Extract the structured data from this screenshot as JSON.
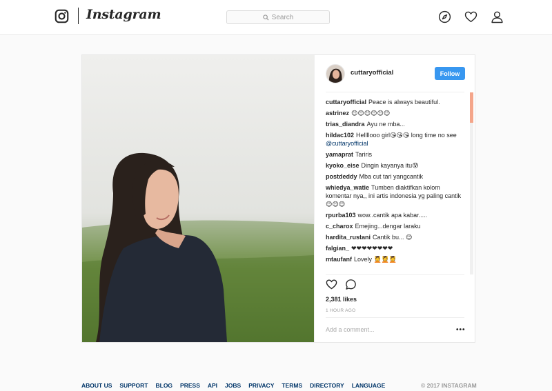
{
  "app": {
    "name": "Instagram"
  },
  "search": {
    "placeholder": "Search"
  },
  "post": {
    "username": "cuttaryofficial",
    "follow_label": "Follow",
    "likes": "2,381 likes",
    "time": "1 HOUR AGO",
    "add_comment_placeholder": "Add a comment...",
    "more_label": "•••",
    "comments": [
      {
        "user": "cuttaryofficial",
        "text": "Peace is always beautiful."
      },
      {
        "user": "astrinez",
        "text": "😊😊😊😊😊😊"
      },
      {
        "user": "trias_diandra",
        "text": "Ayu ne mba..."
      },
      {
        "user": "hildac102",
        "text": "Hellllooo girl😘😘😘 long time no see",
        "mention": "@cuttaryofficial"
      },
      {
        "user": "yamaprat",
        "text": "Tariris"
      },
      {
        "user": "kyoko_eise",
        "text": "Dingin kayanya itu😰"
      },
      {
        "user": "postdeddy",
        "text": "Mba cut tari yangcantik"
      },
      {
        "user": "whiedya_watie",
        "text": "Tumben diaktifkan kolom komentar nya,, ini artis indonesia yg paling cantik 😊😊😊"
      },
      {
        "user": "rpurba103",
        "text": "wow..cantik apa kabar....."
      },
      {
        "user": "c_charox",
        "text": "Emejing...dengar laraku"
      },
      {
        "user": "hardita_rustani",
        "text": "Cantik bu... 😊"
      },
      {
        "user": "falgian_",
        "text": "❤❤❤❤❤❤❤❤"
      },
      {
        "user": "mtaufanf",
        "text": "Lovely 💆💆💆"
      }
    ]
  },
  "footer": {
    "links": [
      "ABOUT US",
      "SUPPORT",
      "BLOG",
      "PRESS",
      "API",
      "JOBS",
      "PRIVACY",
      "TERMS",
      "DIRECTORY",
      "LANGUAGE"
    ],
    "copyright": "© 2017 INSTAGRAM"
  },
  "colors": {
    "accent": "#3897f0",
    "link": "#003569",
    "scroll_thumb": "#f4a58a"
  },
  "icons": [
    "instagram-icon",
    "search-icon",
    "explore-icon",
    "heart-icon",
    "profile-icon",
    "like-icon",
    "comment-icon"
  ]
}
